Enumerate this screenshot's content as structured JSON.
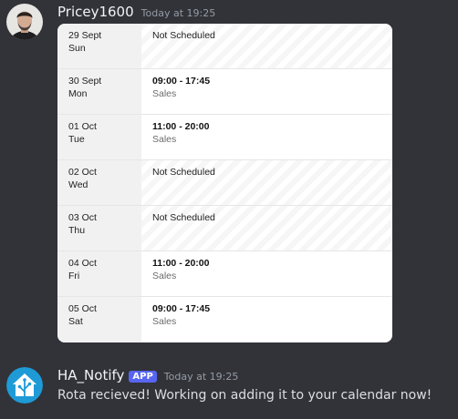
{
  "messages": [
    {
      "author": "Pricey1600",
      "timestamp": "Today at 19:25"
    },
    {
      "author": "HA_Notify",
      "badge": "APP",
      "timestamp": "Today at 19:25",
      "text": "Rota recieved! Working on adding it to your calendar now!"
    }
  ],
  "rota": {
    "days": [
      {
        "date": "29 Sept",
        "weekday": "Sun",
        "status": "Not Scheduled"
      },
      {
        "date": "30 Sept",
        "weekday": "Mon",
        "time": "09:00 - 17:45",
        "role": "Sales"
      },
      {
        "date": "01 Oct",
        "weekday": "Tue",
        "time": "11:00 - 20:00",
        "role": "Sales"
      },
      {
        "date": "02 Oct",
        "weekday": "Wed",
        "status": "Not Scheduled"
      },
      {
        "date": "03 Oct",
        "weekday": "Thu",
        "status": "Not Scheduled"
      },
      {
        "date": "04 Oct",
        "weekday": "Fri",
        "time": "11:00 - 20:00",
        "role": "Sales"
      },
      {
        "date": "05 Oct",
        "weekday": "Sat",
        "time": "09:00 - 17:45",
        "role": "Sales"
      }
    ]
  },
  "colors": {
    "background": "#323339",
    "app_badge": "#5865f2",
    "bot_avatar": "#1e9bd7"
  },
  "icons": {
    "user_avatar": "person-avatar",
    "bot_avatar": "home-assistant-logo"
  }
}
